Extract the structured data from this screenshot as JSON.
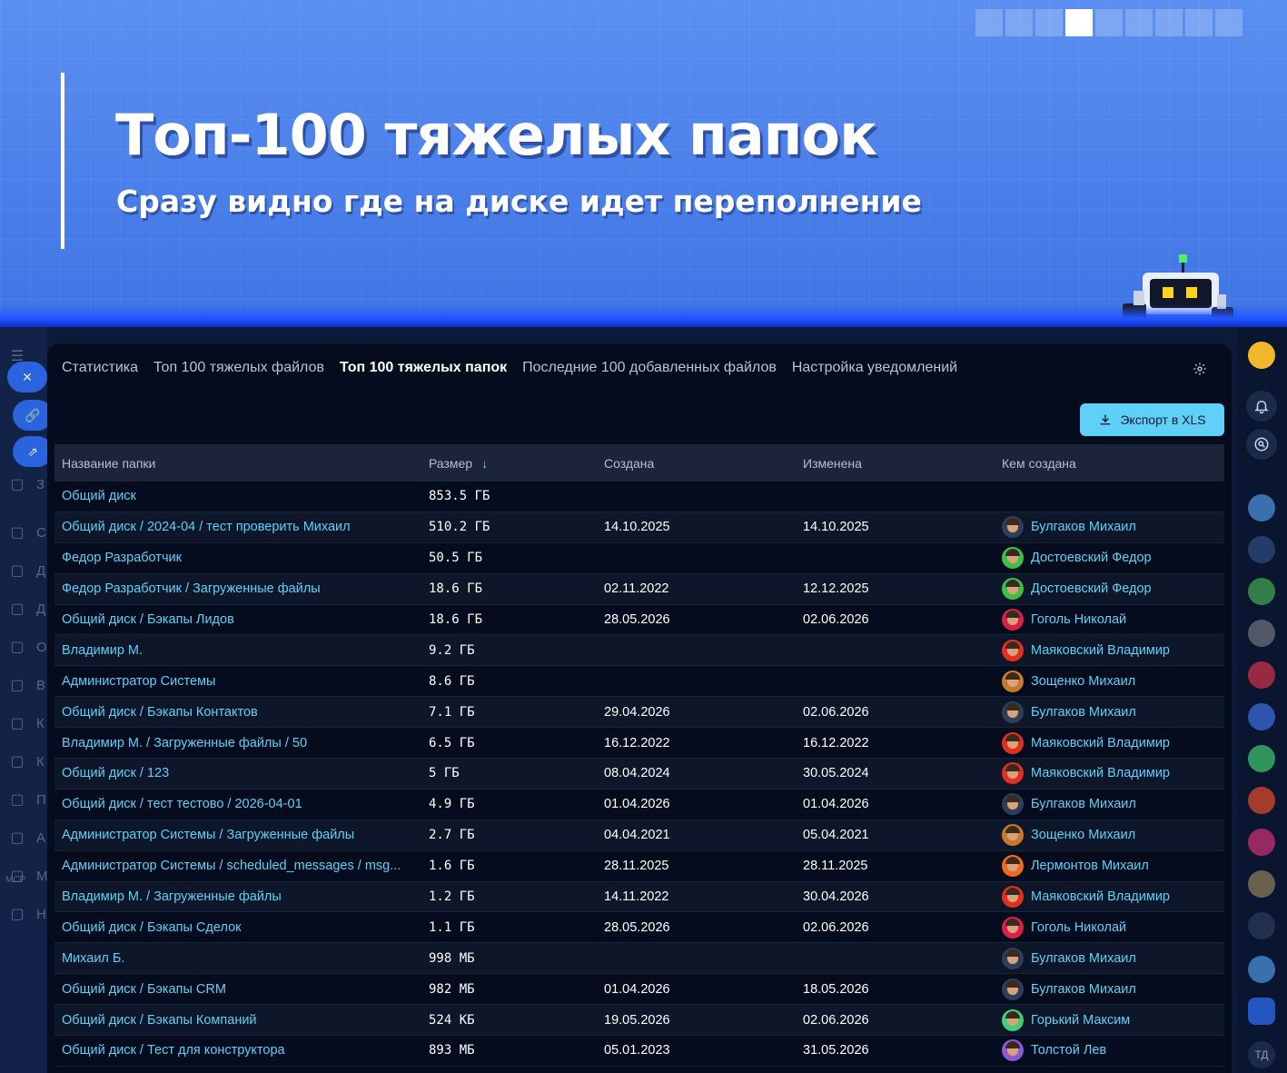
{
  "banner": {
    "title": "Топ-100 тяжелых папок",
    "subtitle": "Сразу видно где на диске идет переполнение",
    "slides_total": 9,
    "slide_active": 4
  },
  "tabs": [
    {
      "label": "Статистика",
      "active": false
    },
    {
      "label": "Топ 100 тяжелых файлов",
      "active": false
    },
    {
      "label": "Топ 100 тяжелых папок",
      "active": true
    },
    {
      "label": "Последние 100 добавленных файлов",
      "active": false
    },
    {
      "label": "Настройка уведомлений",
      "active": false
    }
  ],
  "toolbar": {
    "export_label": "Экспорт в XLS"
  },
  "table": {
    "columns": {
      "name": "Название папки",
      "size": "Размер",
      "created": "Создана",
      "modified": "Изменена",
      "author": "Кем создана"
    },
    "rows": [
      {
        "name": "Общий диск",
        "size": "853.5 ГБ",
        "created": "",
        "modified": "",
        "author": ""
      },
      {
        "name": "Общий диск / 2024-04 / тест проверить Михаил",
        "size": "510.2 ГБ",
        "created": "14.10.2025",
        "modified": "14.10.2025",
        "author": "Булгаков Михаил"
      },
      {
        "name": "Федор Разработчик",
        "size": "50.5 ГБ",
        "created": "",
        "modified": "",
        "author": "Достоевский Федор"
      },
      {
        "name": "Федор Разработчик / Загруженные файлы",
        "size": "18.6 ГБ",
        "created": "02.11.2022",
        "modified": "12.12.2025",
        "author": "Достоевский Федор"
      },
      {
        "name": "Общий диск / Бэкапы Лидов",
        "size": "18.6 ГБ",
        "created": "28.05.2026",
        "modified": "02.06.2026",
        "author": "Гоголь Николай"
      },
      {
        "name": "Владимир М.",
        "size": "9.2 ГБ",
        "created": "",
        "modified": "",
        "author": "Маяковский Владимир"
      },
      {
        "name": "Администратор Системы",
        "size": "8.6 ГБ",
        "created": "",
        "modified": "",
        "author": "Зощенко Михаил"
      },
      {
        "name": "Общий диск / Бэкапы Контактов",
        "size": "7.1 ГБ",
        "created": "29.04.2026",
        "modified": "02.06.2026",
        "author": "Булгаков Михаил"
      },
      {
        "name": "Владимир М. / Загруженные файлы / 50",
        "size": "6.5 ГБ",
        "created": "16.12.2022",
        "modified": "16.12.2022",
        "author": "Маяковский Владимир"
      },
      {
        "name": "Общий диск / 123",
        "size": "5 ГБ",
        "created": "08.04.2024",
        "modified": "30.05.2024",
        "author": "Маяковский Владимир"
      },
      {
        "name": "Общий диск / тест тестово / 2026-04-01",
        "size": "4.9 ГБ",
        "created": "01.04.2026",
        "modified": "01.04.2026",
        "author": "Булгаков Михаил"
      },
      {
        "name": "Администратор Системы / Загруженные файлы",
        "size": "2.7 ГБ",
        "created": "04.04.2021",
        "modified": "05.04.2021",
        "author": "Зощенко Михаил"
      },
      {
        "name": "Администратор Системы / scheduled_messages / msg...",
        "size": "1.6 ГБ",
        "created": "28.11.2025",
        "modified": "28.11.2025",
        "author": "Лермонтов Михаил"
      },
      {
        "name": "Владимир М. / Загруженные файлы",
        "size": "1.2 ГБ",
        "created": "14.11.2022",
        "modified": "30.04.2026",
        "author": "Маяковский Владимир"
      },
      {
        "name": "Общий диск / Бэкапы Сделок",
        "size": "1.1 ГБ",
        "created": "28.05.2026",
        "modified": "02.06.2026",
        "author": "Гоголь Николай"
      },
      {
        "name": "Михаил Б.",
        "size": "998 МБ",
        "created": "",
        "modified": "",
        "author": "Булгаков Михаил"
      },
      {
        "name": "Общий диск / Бэкапы CRM",
        "size": "982 МБ",
        "created": "01.04.2026",
        "modified": "18.05.2026",
        "author": "Булгаков Михаил"
      },
      {
        "name": "Общий диск / Бэкапы Компаний",
        "size": "524 КБ",
        "created": "19.05.2026",
        "modified": "02.06.2026",
        "author": "Горький Максим"
      },
      {
        "name": "Общий диск / Тест для конструктора",
        "size": "893 МБ",
        "created": "05.01.2023",
        "modified": "31.05.2026",
        "author": "Толстой Лев"
      }
    ]
  },
  "avatar_colors": {
    "Булгаков Михаил": "#2a3f5c",
    "Достоевский Федор": "#3fbf4a",
    "Гоголь Николай": "#d8204a",
    "Маяковский Владимир": "#e0301e",
    "Зощенко Михаил": "#c77a2b",
    "Лермонтов Михаил": "#ef6a1d",
    "Горький Максим": "#3ecf7a",
    "Толстой Лев": "#8b58d8"
  },
  "sidebar": {
    "labels": [
      "З",
      "С",
      "Д",
      "Д",
      "О",
      "В",
      "К",
      "К",
      "П",
      "А",
      "М",
      "Н"
    ],
    "mcp_label": "MCP"
  },
  "right_rail": {
    "initials": "ТД"
  },
  "colors": {
    "accent": "#5fd0f7",
    "panel": "#050c1d",
    "banner": "#4a7de6"
  }
}
